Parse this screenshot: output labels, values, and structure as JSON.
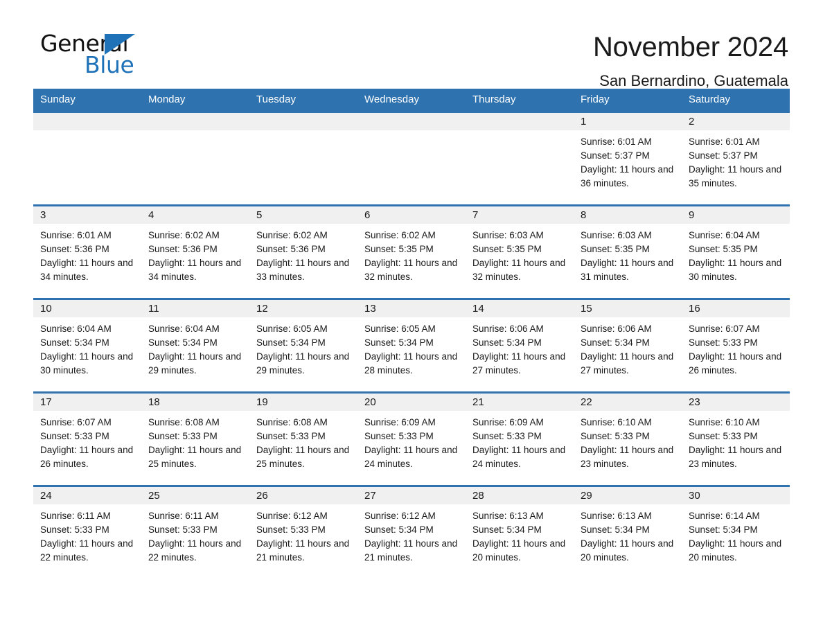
{
  "brand": {
    "name_part1": "General",
    "name_part2": "Blue",
    "accent_color": "#1f72b8"
  },
  "header": {
    "month_title": "November 2024",
    "location": "San Bernardino, Guatemala",
    "header_bg_color": "#2e72b0",
    "daynum_bg_color": "#f0f0f0"
  },
  "weekday_headers": [
    "Sunday",
    "Monday",
    "Tuesday",
    "Wednesday",
    "Thursday",
    "Friday",
    "Saturday"
  ],
  "labels": {
    "sunrise_prefix": "Sunrise:",
    "sunset_prefix": "Sunset:",
    "daylight_prefix": "Daylight:"
  },
  "weeks": [
    [
      {
        "day": "",
        "blank": true
      },
      {
        "day": "",
        "blank": true
      },
      {
        "day": "",
        "blank": true
      },
      {
        "day": "",
        "blank": true
      },
      {
        "day": "",
        "blank": true
      },
      {
        "day": "1",
        "sunrise": "Sunrise: 6:01 AM",
        "sunset": "Sunset: 5:37 PM",
        "daylight": "Daylight: 11 hours and 36 minutes."
      },
      {
        "day": "2",
        "sunrise": "Sunrise: 6:01 AM",
        "sunset": "Sunset: 5:37 PM",
        "daylight": "Daylight: 11 hours and 35 minutes."
      }
    ],
    [
      {
        "day": "3",
        "sunrise": "Sunrise: 6:01 AM",
        "sunset": "Sunset: 5:36 PM",
        "daylight": "Daylight: 11 hours and 34 minutes."
      },
      {
        "day": "4",
        "sunrise": "Sunrise: 6:02 AM",
        "sunset": "Sunset: 5:36 PM",
        "daylight": "Daylight: 11 hours and 34 minutes."
      },
      {
        "day": "5",
        "sunrise": "Sunrise: 6:02 AM",
        "sunset": "Sunset: 5:36 PM",
        "daylight": "Daylight: 11 hours and 33 minutes."
      },
      {
        "day": "6",
        "sunrise": "Sunrise: 6:02 AM",
        "sunset": "Sunset: 5:35 PM",
        "daylight": "Daylight: 11 hours and 32 minutes."
      },
      {
        "day": "7",
        "sunrise": "Sunrise: 6:03 AM",
        "sunset": "Sunset: 5:35 PM",
        "daylight": "Daylight: 11 hours and 32 minutes."
      },
      {
        "day": "8",
        "sunrise": "Sunrise: 6:03 AM",
        "sunset": "Sunset: 5:35 PM",
        "daylight": "Daylight: 11 hours and 31 minutes."
      },
      {
        "day": "9",
        "sunrise": "Sunrise: 6:04 AM",
        "sunset": "Sunset: 5:35 PM",
        "daylight": "Daylight: 11 hours and 30 minutes."
      }
    ],
    [
      {
        "day": "10",
        "sunrise": "Sunrise: 6:04 AM",
        "sunset": "Sunset: 5:34 PM",
        "daylight": "Daylight: 11 hours and 30 minutes."
      },
      {
        "day": "11",
        "sunrise": "Sunrise: 6:04 AM",
        "sunset": "Sunset: 5:34 PM",
        "daylight": "Daylight: 11 hours and 29 minutes."
      },
      {
        "day": "12",
        "sunrise": "Sunrise: 6:05 AM",
        "sunset": "Sunset: 5:34 PM",
        "daylight": "Daylight: 11 hours and 29 minutes."
      },
      {
        "day": "13",
        "sunrise": "Sunrise: 6:05 AM",
        "sunset": "Sunset: 5:34 PM",
        "daylight": "Daylight: 11 hours and 28 minutes."
      },
      {
        "day": "14",
        "sunrise": "Sunrise: 6:06 AM",
        "sunset": "Sunset: 5:34 PM",
        "daylight": "Daylight: 11 hours and 27 minutes."
      },
      {
        "day": "15",
        "sunrise": "Sunrise: 6:06 AM",
        "sunset": "Sunset: 5:34 PM",
        "daylight": "Daylight: 11 hours and 27 minutes."
      },
      {
        "day": "16",
        "sunrise": "Sunrise: 6:07 AM",
        "sunset": "Sunset: 5:33 PM",
        "daylight": "Daylight: 11 hours and 26 minutes."
      }
    ],
    [
      {
        "day": "17",
        "sunrise": "Sunrise: 6:07 AM",
        "sunset": "Sunset: 5:33 PM",
        "daylight": "Daylight: 11 hours and 26 minutes."
      },
      {
        "day": "18",
        "sunrise": "Sunrise: 6:08 AM",
        "sunset": "Sunset: 5:33 PM",
        "daylight": "Daylight: 11 hours and 25 minutes."
      },
      {
        "day": "19",
        "sunrise": "Sunrise: 6:08 AM",
        "sunset": "Sunset: 5:33 PM",
        "daylight": "Daylight: 11 hours and 25 minutes."
      },
      {
        "day": "20",
        "sunrise": "Sunrise: 6:09 AM",
        "sunset": "Sunset: 5:33 PM",
        "daylight": "Daylight: 11 hours and 24 minutes."
      },
      {
        "day": "21",
        "sunrise": "Sunrise: 6:09 AM",
        "sunset": "Sunset: 5:33 PM",
        "daylight": "Daylight: 11 hours and 24 minutes."
      },
      {
        "day": "22",
        "sunrise": "Sunrise: 6:10 AM",
        "sunset": "Sunset: 5:33 PM",
        "daylight": "Daylight: 11 hours and 23 minutes."
      },
      {
        "day": "23",
        "sunrise": "Sunrise: 6:10 AM",
        "sunset": "Sunset: 5:33 PM",
        "daylight": "Daylight: 11 hours and 23 minutes."
      }
    ],
    [
      {
        "day": "24",
        "sunrise": "Sunrise: 6:11 AM",
        "sunset": "Sunset: 5:33 PM",
        "daylight": "Daylight: 11 hours and 22 minutes."
      },
      {
        "day": "25",
        "sunrise": "Sunrise: 6:11 AM",
        "sunset": "Sunset: 5:33 PM",
        "daylight": "Daylight: 11 hours and 22 minutes."
      },
      {
        "day": "26",
        "sunrise": "Sunrise: 6:12 AM",
        "sunset": "Sunset: 5:33 PM",
        "daylight": "Daylight: 11 hours and 21 minutes."
      },
      {
        "day": "27",
        "sunrise": "Sunrise: 6:12 AM",
        "sunset": "Sunset: 5:34 PM",
        "daylight": "Daylight: 11 hours and 21 minutes."
      },
      {
        "day": "28",
        "sunrise": "Sunrise: 6:13 AM",
        "sunset": "Sunset: 5:34 PM",
        "daylight": "Daylight: 11 hours and 20 minutes."
      },
      {
        "day": "29",
        "sunrise": "Sunrise: 6:13 AM",
        "sunset": "Sunset: 5:34 PM",
        "daylight": "Daylight: 11 hours and 20 minutes."
      },
      {
        "day": "30",
        "sunrise": "Sunrise: 6:14 AM",
        "sunset": "Sunset: 5:34 PM",
        "daylight": "Daylight: 11 hours and 20 minutes."
      }
    ]
  ]
}
